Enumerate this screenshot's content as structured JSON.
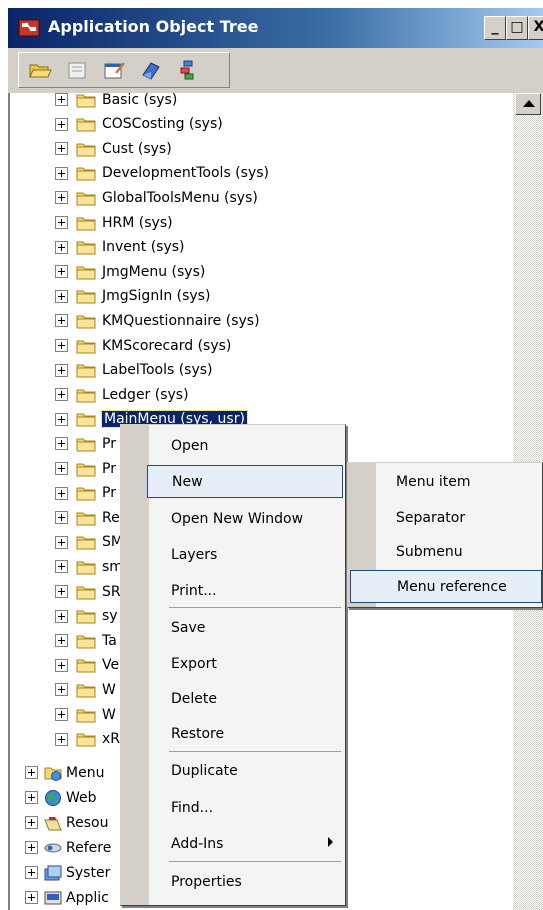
{
  "window": {
    "title": "Application Object Tree",
    "controls": {
      "minimize": "_",
      "maximize": "□",
      "close": "X"
    }
  },
  "toolbar": {
    "buttons": [
      {
        "icon": "open-folder-icon"
      },
      {
        "icon": "new-icon"
      },
      {
        "icon": "properties-icon"
      },
      {
        "icon": "compile-icon"
      },
      {
        "icon": "layers-icon"
      }
    ]
  },
  "tree": {
    "items": [
      {
        "label": "Basic (sys)"
      },
      {
        "label": "COSCosting (sys)"
      },
      {
        "label": "Cust (sys)"
      },
      {
        "label": "DevelopmentTools (sys)"
      },
      {
        "label": "GlobalToolsMenu (sys)"
      },
      {
        "label": "HRM (sys)"
      },
      {
        "label": "Invent (sys)"
      },
      {
        "label": "JmgMenu (sys)"
      },
      {
        "label": "JmgSignIn (sys)"
      },
      {
        "label": "KMQuestionnaire (sys)"
      },
      {
        "label": "KMScorecard (sys)"
      },
      {
        "label": "LabelTools (sys)"
      },
      {
        "label": "Ledger (sys)"
      },
      {
        "label": "MainMenu (sys, usr)"
      },
      {
        "label": "Pr"
      },
      {
        "label": "Pr"
      },
      {
        "label": "Pr"
      },
      {
        "label": "Re"
      },
      {
        "label": "SM"
      },
      {
        "label": "sm"
      },
      {
        "label": "SR"
      },
      {
        "label": "sy"
      },
      {
        "label": "Ta"
      },
      {
        "label": "Ve"
      },
      {
        "label": "W"
      },
      {
        "label": "W"
      },
      {
        "label": "xR"
      }
    ],
    "root_items": [
      {
        "label": "Menu",
        "icon": "menu-items-icon"
      },
      {
        "label": "Web",
        "icon": "web-globe-icon"
      },
      {
        "label": "Resou",
        "icon": "resources-icon"
      },
      {
        "label": "Refere",
        "icon": "references-icon"
      },
      {
        "label": "Syster",
        "icon": "system-documentation-icon"
      },
      {
        "label": "Applic",
        "icon": "application-documentation-icon"
      }
    ]
  },
  "context_menu": {
    "items": [
      {
        "label": "Open"
      },
      {
        "label": "New",
        "highlighted": true
      },
      {
        "label": "Open New Window"
      },
      {
        "label": "Layers"
      },
      {
        "label": "Print..."
      },
      {
        "label": "Save"
      },
      {
        "label": "Export"
      },
      {
        "label": "Delete"
      },
      {
        "label": "Restore"
      },
      {
        "label": "Duplicate"
      },
      {
        "label": "Find..."
      },
      {
        "label": "Add-Ins",
        "has_submenu": true
      },
      {
        "label": "Properties"
      }
    ]
  },
  "submenu": {
    "items": [
      {
        "label": "Menu item"
      },
      {
        "label": "Separator"
      },
      {
        "label": "Submenu"
      },
      {
        "label": "Menu reference",
        "highlighted": true
      }
    ]
  },
  "colors": {
    "title_bar_start": "#0a246a",
    "title_bar_end": "#a6caf0",
    "selection": "#0a246a",
    "folder": "#f5d76e",
    "menu_highlight_border": "#1e4a8a"
  }
}
